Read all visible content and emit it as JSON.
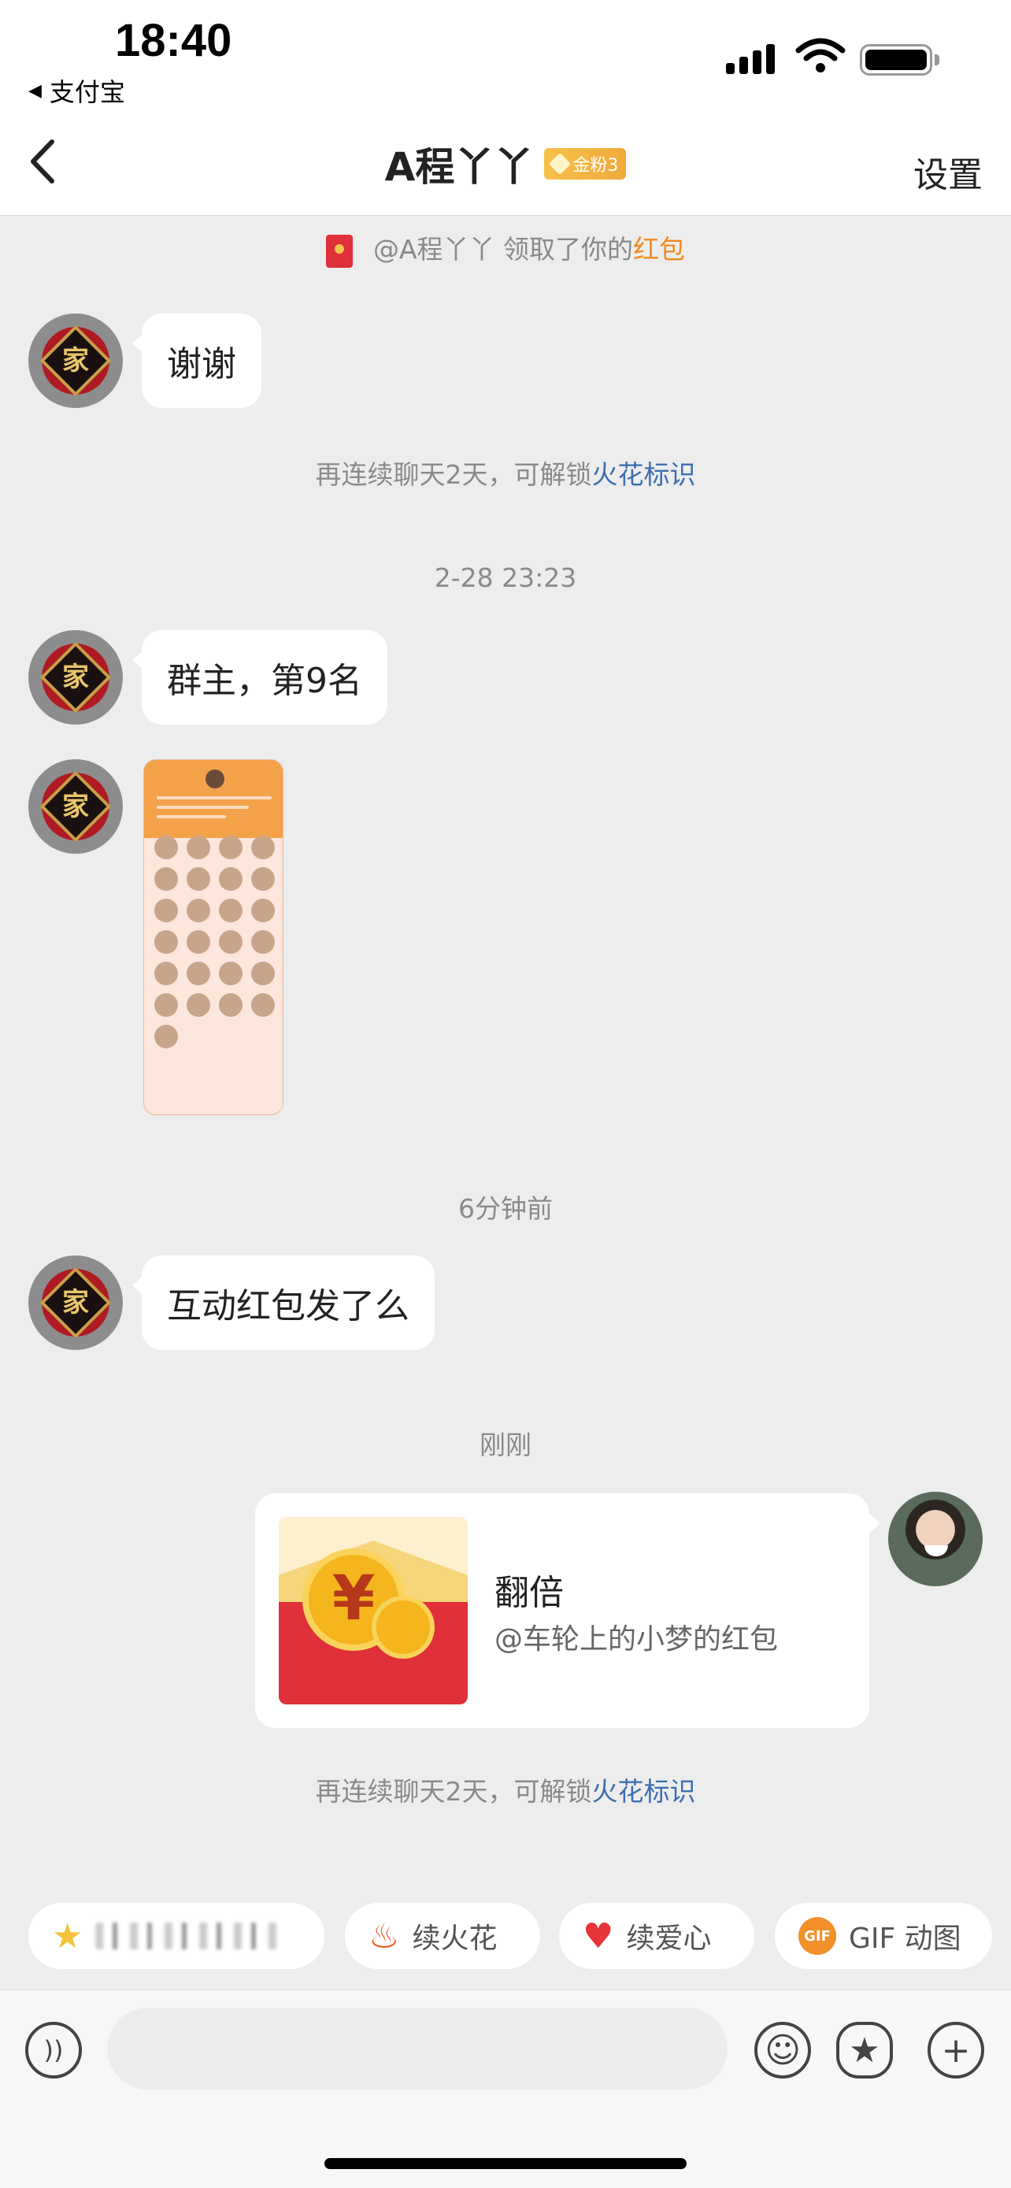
{
  "status_bar": {
    "time": "18:40",
    "back_app": "支付宝"
  },
  "header": {
    "back_icon": "chevron-left-icon",
    "title": "A程丫丫",
    "fan_badge": "金粉3",
    "settings": "设置"
  },
  "messages": {
    "redpacket_notice_prefix": "@A程丫丫 领取了你的",
    "redpacket_notice_link": "红包",
    "msg1": "谢谢",
    "streak_notice_1_prefix": "再连续聊天2天，可解锁",
    "streak_notice_1_link": "火花标识",
    "time_divider_1": "2-28 23:23",
    "msg2": "群主，第9名",
    "time_divider_2": "6分钟前",
    "msg3": "互动红包发了么",
    "time_divider_3": "刚刚",
    "red_packet": {
      "title": "翻倍",
      "subtitle": "@车轮上的小梦的红包"
    },
    "streak_notice_2_prefix": "再连续聊天2天，可解锁",
    "streak_notice_2_link": "火花标识"
  },
  "quick_actions": {
    "chip_1_icon": "star-face-icon",
    "chip_2_label": "续火花",
    "chip_2_icon": "fire-icon",
    "chip_3_label": "续爱心",
    "chip_3_icon": "heart-icon",
    "chip_4_label": "GIF 动图",
    "chip_4_icon_text": "GIF"
  },
  "input_bar": {
    "voice_icon": "voice-icon",
    "placeholder": "",
    "emoji_icon": "emoji-icon",
    "sticker_icon": "sticker-icon",
    "plus_icon": "plus-icon"
  },
  "colors": {
    "background": "#ededed",
    "link_blue": "#3d6fb0",
    "link_orange": "#f08a1d",
    "red_packet": "#e0303a"
  }
}
